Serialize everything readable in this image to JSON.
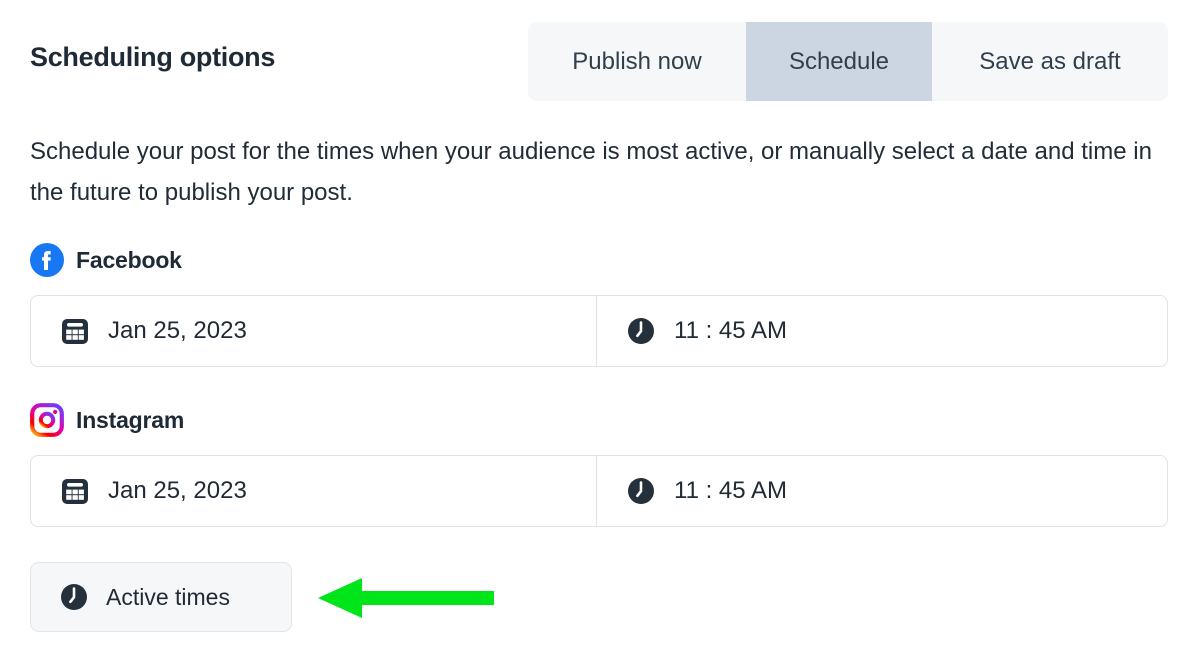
{
  "header": {
    "title": "Scheduling options"
  },
  "tabs": [
    {
      "label": "Publish now",
      "selected": false,
      "name": "tab-publish-now"
    },
    {
      "label": "Schedule",
      "selected": true,
      "name": "tab-schedule"
    },
    {
      "label": "Save as draft",
      "selected": false,
      "name": "tab-save-as-draft"
    }
  ],
  "description": "Schedule your post for the times when your audience is most active, or manually select a date and time in the future to publish your post.",
  "networks": [
    {
      "name": "Facebook",
      "icon": "facebook-icon",
      "date": "Jan 25, 2023",
      "time": "11 : 45 AM",
      "date_icon": "calendar-icon",
      "time_icon": "clock-icon"
    },
    {
      "name": "Instagram",
      "icon": "instagram-icon",
      "date": "Jan 25, 2023",
      "time": "11 : 45 AM",
      "date_icon": "calendar-icon",
      "time_icon": "clock-icon"
    }
  ],
  "active_times_button": {
    "label": "Active times",
    "icon": "clock-icon"
  },
  "annotation": {
    "type": "arrow-left",
    "color": "#00e519"
  },
  "colors": {
    "tab_selected_bg": "#ccd6e2",
    "tab_group_bg": "#f6f7f9",
    "text_primary": "#212b36",
    "border": "#dfe3e8",
    "facebook_blue": "#1877f2",
    "arrow_green": "#00e519"
  }
}
